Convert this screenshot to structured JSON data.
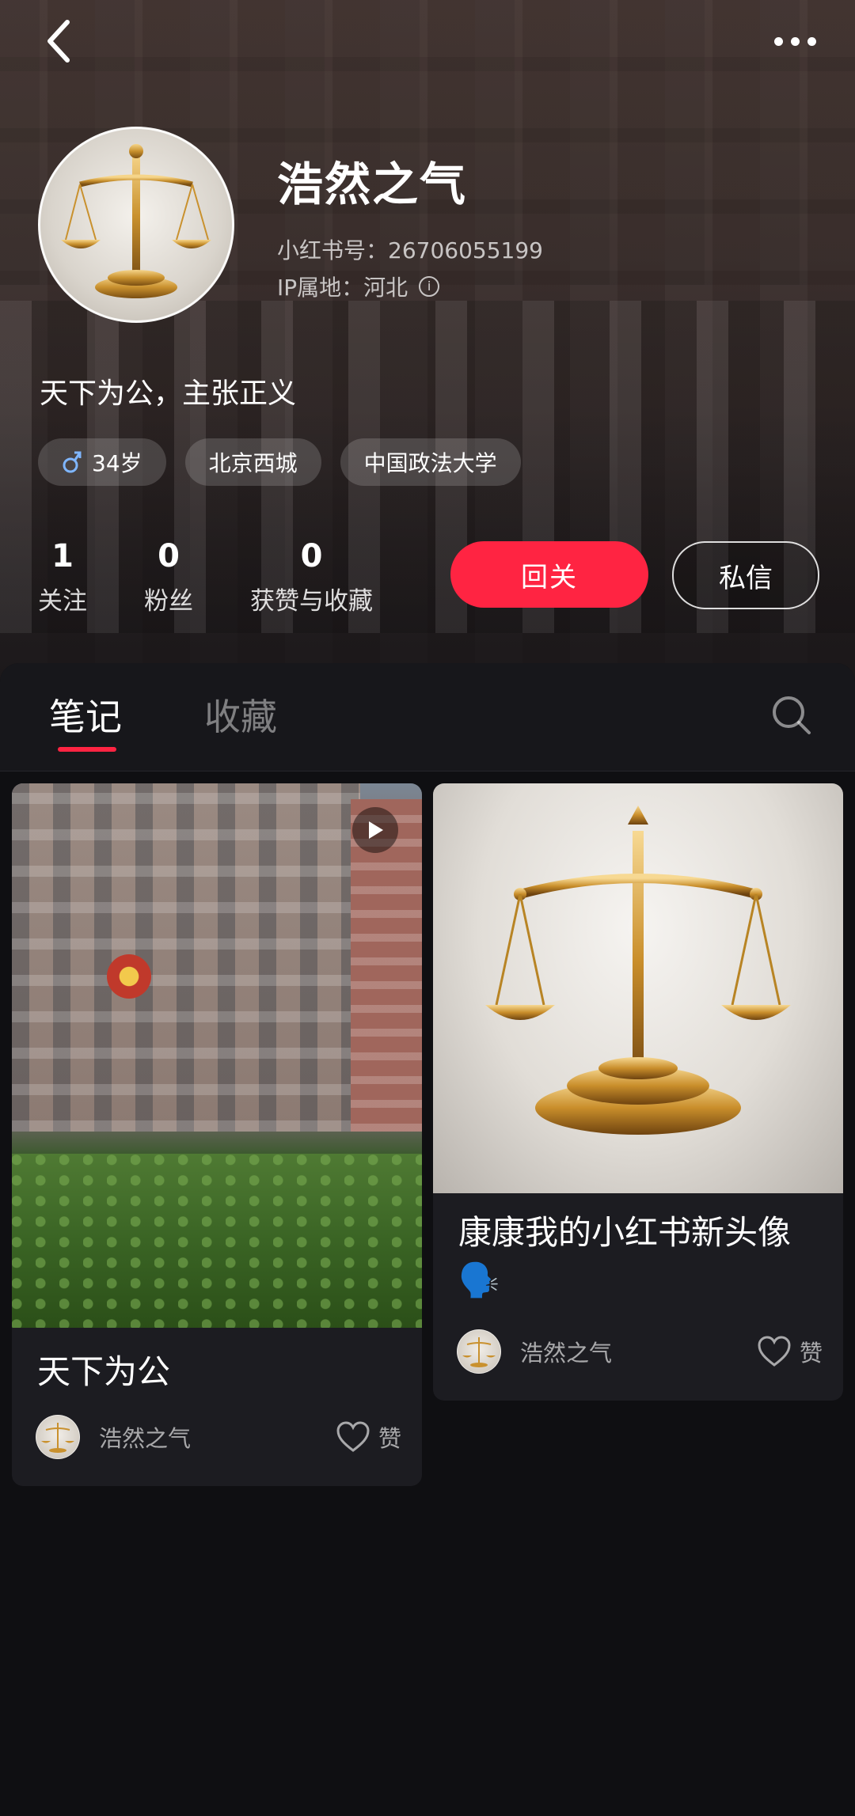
{
  "profile": {
    "nickname": "浩然之气",
    "red_id": "小红书号：26706055199",
    "ip": "IP属地：河北",
    "bio": "天下为公，主张正义",
    "tags": [
      {
        "icon": "male-icon",
        "label": "34岁"
      },
      {
        "label": "北京西城"
      },
      {
        "label": "中国政法大学"
      }
    ],
    "stats": [
      {
        "num": "1",
        "label": "关注"
      },
      {
        "num": "0",
        "label": "粉丝"
      },
      {
        "num": "0",
        "label": "获赞与收藏"
      }
    ],
    "follow_back_label": "回关",
    "message_label": "私信"
  },
  "tabs": [
    {
      "label": "笔记",
      "active": true
    },
    {
      "label": "收藏",
      "active": false
    }
  ],
  "notes": [
    {
      "title": "天下为公",
      "author": "浩然之气",
      "like_label": "赞",
      "is_video": true,
      "image": "court-building-photo"
    },
    {
      "title": "康康我的小红书新头像🗣️",
      "author": "浩然之气",
      "like_label": "赞",
      "is_video": false,
      "image": "scales-of-justice"
    }
  ],
  "colors": {
    "accent": "#ff2442",
    "background": "#0f0f12",
    "card": "#1c1c21"
  }
}
